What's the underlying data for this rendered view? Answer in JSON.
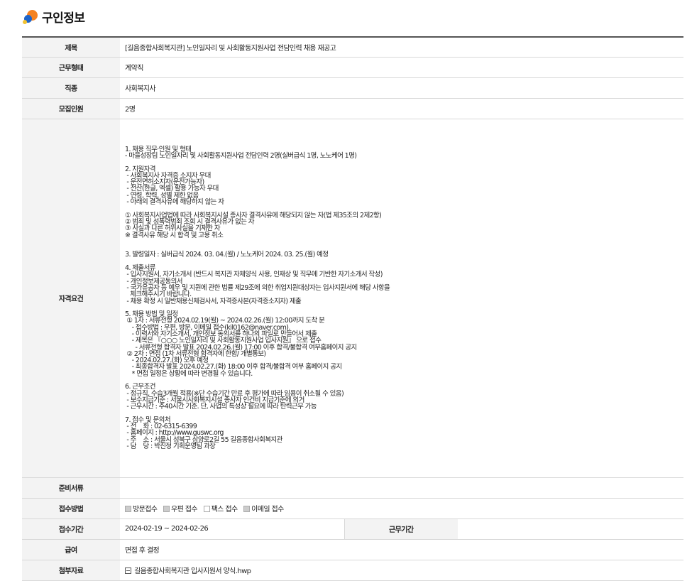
{
  "page": {
    "title": "구인정보"
  },
  "rows": {
    "title": {
      "label": "제목",
      "value": "[길음종합사회복지관] 노인일자리 및 사회활동지원사업 전담인력 채용 재공고"
    },
    "employment_type": {
      "label": "근무형태",
      "value": "계약직"
    },
    "job_type": {
      "label": "직종",
      "value": "사회복지사"
    },
    "headcount": {
      "label": "모집인원",
      "value": "2명"
    },
    "requirements": {
      "label": "자격요건",
      "value": "1. 채용 직무·인원 및 형태\n- 마을성장팀 노인일자리 및 사회활동지원사업 전담인력 2명(실버급식 1명, 노노케어 1명)\n\n2. 지원자격\n - 사회복지사 자격증 소지자 우대\n - 운전면허소지자(운전가능자)\n - 전산(한글, 엑셀) 활용 가능자 우대\n - 연령, 학력, 성별 제한 없음\n - 아래의 결격사유에 해당하지 않는 자\n\n① 사회복지사업법에 따라 사회복지시설 종사자 결격사유에 해당되지 않는 자(법 제35조의 2제2항)\n② 범죄 및 성폭력범죄 조회 시 결격사유가 없는 자\n③ 사실과 다른 허위사실을 기재한 자\n※ 결격사유 해당 시 합격 및 고용 취소\n\n\n3. 발령일자 : 실버급식 2024. 03. 04.(월) / 노노케어 2024. 03. 25.(월) 예정\n\n4. 제출서류\n - 입사지원서, 자기소개서 (반드시 복지관 자체양식 사용, 인재상 및 직무에 기반한 자기소개서 작성)\n - 개인정보제공동의서\n - 국가유공자 등 예우 및 지원에 관한 법률 제29조에 의한 취업지원대상자는 입사지원서에 해당 사항을\n   체크해주시기 바랍니다.\n - 채용 확정 시 일반채용신체검사서, 자격증사본(자격증소지자) 제출\n\n5. 채용 방법 및 일정\n ① 1차 : 서류전형 2024.02.19(월) ~ 2024.02.26.(월) 12:00까지 도착 분\n    - 접수방법 : 우편, 방문, 이메일 접수(kil0162@naver.com).\n    - 이력서와 자기소개서, 개인정보 동의서를 하나의 파일로 만들어서 제출\n    - 제목은 『○○○ 노인일자리 및 사회활동지원사업 입사지원』 으로 접수\n      - 서류전형 합격자 발표 2024.02.26.(월) 17:00 이후 합격/불합격 여부홈페이지 공지\n ② 2차 : 면접 (1차 서류전형 합격자에 한함/ 개별통보)\n    - 2024.02.27.(화) 오후 예정\n    - 최종합격자 발표 2024.02.27.(화) 18:00 이후 합격/불합격 여부 홈페이지 공지\n    * 면접 일정은 상황에 따라 변경될 수 있습니다.\n\n6. 근무조건\n - 정규직, 수습3개월 적용(※단 수습기간 만료 후 평가에 따라 임용이 취소될 수 있음)\n - 보수지급기준 : 서울시사회복지시설 종사자 인건비 지급기준에 의거\n - 근무시간 : 주40시간 기준. 단, 사업의 특성상 필요에 따라 탄력근무 가능\n\n7. 접수 및 문의처\n - 전    화 : 02-6315-6399\n - 홈페이지 : http://www.guswc.org\n - 주    소 : 서울시 성북구 삼양로2길 55 길음종합사회복지관\n - 담    당 : 박진정 기획운영팀 과장"
    },
    "documents": {
      "label": "준비서류",
      "value": ""
    },
    "methods": {
      "label": "접수방법",
      "options": [
        {
          "label": "방문접수",
          "checked": true
        },
        {
          "label": "우편 접수",
          "checked": true
        },
        {
          "label": "팩스 접수",
          "checked": false
        },
        {
          "label": "이메일 접수",
          "checked": true
        }
      ]
    },
    "period": {
      "label": "접수기간",
      "value": "2024-02-19 ~ 2024-02-26",
      "work_label": "근무기간",
      "work_value": ""
    },
    "salary": {
      "label": "급여",
      "value": "면접 후 결정"
    },
    "attachment": {
      "label": "첨부자료",
      "file_name": "길음종합사회복지관 입사지원서 양식.hwp",
      "icon": "file-icon"
    }
  }
}
